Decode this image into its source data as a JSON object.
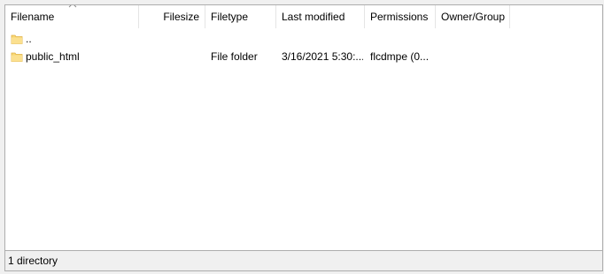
{
  "columns": {
    "filename": "Filename",
    "filesize": "Filesize",
    "filetype": "Filetype",
    "last_modified": "Last modified",
    "permissions": "Permissions",
    "owner_group": "Owner/Group"
  },
  "sort": {
    "column": "filename",
    "direction": "ascending",
    "icon": "sort-up-arrow"
  },
  "rows": [
    {
      "name": "..",
      "size": "",
      "type": "",
      "modified": "",
      "permissions": "",
      "owner": "",
      "icon": "folder-icon"
    },
    {
      "name": "public_html",
      "size": "",
      "type": "File folder",
      "modified": "3/16/2021 5:30:...",
      "permissions": "flcdmpe (0...",
      "owner": "",
      "icon": "folder-icon"
    }
  ],
  "status_bar": {
    "text": "1 directory"
  },
  "colors": {
    "folder_fill": "#f8d775",
    "folder_tab": "#e9b949",
    "border": "#adadad",
    "divider": "#e5e5e5"
  }
}
